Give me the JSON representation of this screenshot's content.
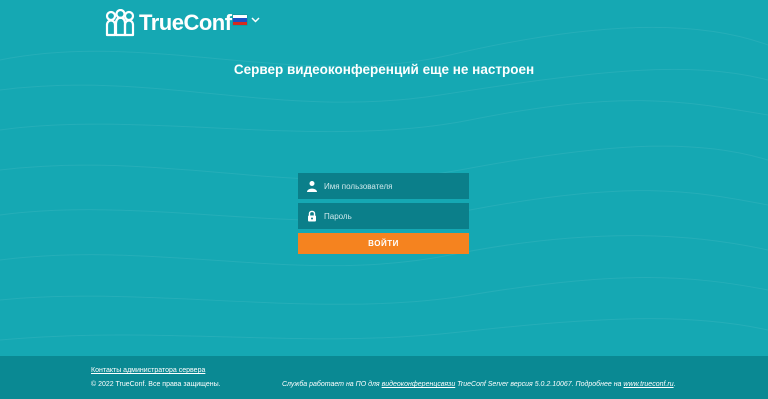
{
  "header": {
    "logo_text": "TrueConf",
    "language_flag_colors": [
      "#ffffff",
      "#1c4fc4",
      "#d52b1e"
    ]
  },
  "main": {
    "title": "Сервер видеоконференций еще не настроен"
  },
  "login": {
    "username_placeholder": "Имя пользователя",
    "password_placeholder": "Пароль",
    "submit_label": "ВОЙТИ"
  },
  "footer": {
    "contacts_link": "Контакты администратора сервера",
    "copyright": "© 2022 TrueConf. Все права защищены.",
    "service_prefix": "Служба работает на ПО для ",
    "service_link": "видеоконференцсвязи",
    "service_middle": " TrueConf Server версия 5.0.2.10067. Подробнее на ",
    "site_link": "www.trueconf.ru",
    "service_suffix": "."
  },
  "colors": {
    "background": "#15a8b3",
    "input_bg": "#0b7f8a",
    "button": "#f5831f",
    "footer_bg": "#0a8993"
  },
  "icons": {
    "username": "user-icon",
    "password": "lock-icon",
    "language": "flag-ru-icon"
  }
}
